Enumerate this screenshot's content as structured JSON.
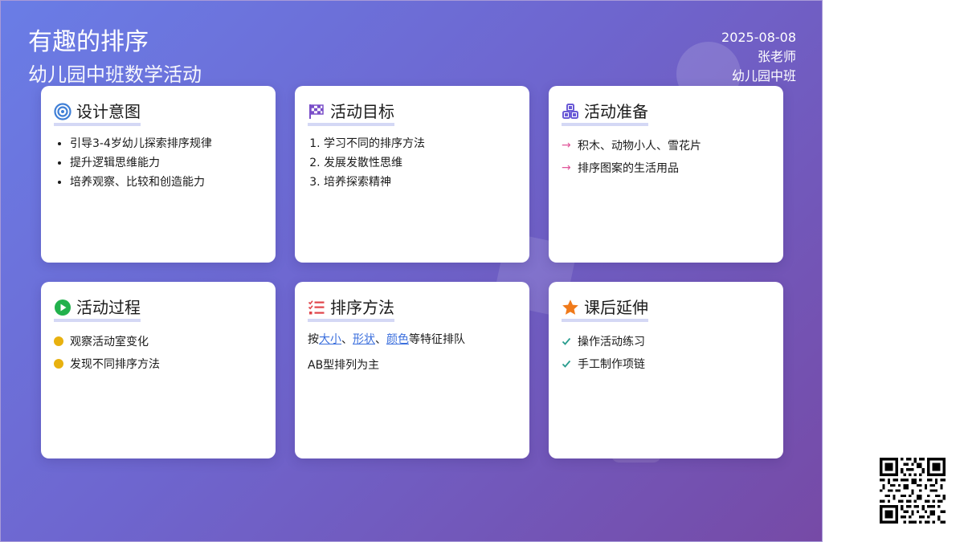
{
  "header": {
    "title": "有趣的排序",
    "subtitle": "幼儿园中班数学活动",
    "date": "2025-08-08",
    "teacher": "张老师",
    "class_name": "幼儿园中班"
  },
  "cards": {
    "design": {
      "title": "设计意图",
      "icon": "target-icon",
      "items": [
        "引导3-4岁幼儿探索排序规律",
        "提升逻辑思维能力",
        "培养观察、比较和创造能力"
      ]
    },
    "goals": {
      "title": "活动目标",
      "icon": "checkered-flag-icon",
      "items": [
        "学习不同的排序方法",
        "发展发散性思维",
        "培养探索精神"
      ]
    },
    "prep": {
      "title": "活动准备",
      "icon": "cubes-icon",
      "items": [
        "积木、动物小人、雪花片",
        "排序图案的生活用品"
      ]
    },
    "process": {
      "title": "活动过程",
      "icon": "play-icon",
      "items": [
        "观察活动室变化",
        "发现不同排序方法"
      ]
    },
    "methods": {
      "title": "排序方法",
      "icon": "list-check-icon",
      "line1_prefix": "按",
      "line1_link1": "大小",
      "line1_sep1": "、",
      "line1_link2": "形状",
      "line1_sep2": "、",
      "line1_link3": "颜色",
      "line1_suffix": "等特征排队",
      "line2": "AB型排列为主"
    },
    "extension": {
      "title": "课后延伸",
      "icon": "star-icon",
      "items": [
        "操作活动练习",
        "手工制作项链"
      ]
    }
  },
  "colors": {
    "gradient_start": "#6a7de6",
    "gradient_end": "#764aa6",
    "accent_pink": "#e0559a",
    "accent_yellow": "#e8b10f",
    "accent_teal": "#2a9d8f",
    "link_blue": "#3b6fdd"
  },
  "qr": {
    "icon": "qr-code-icon"
  }
}
